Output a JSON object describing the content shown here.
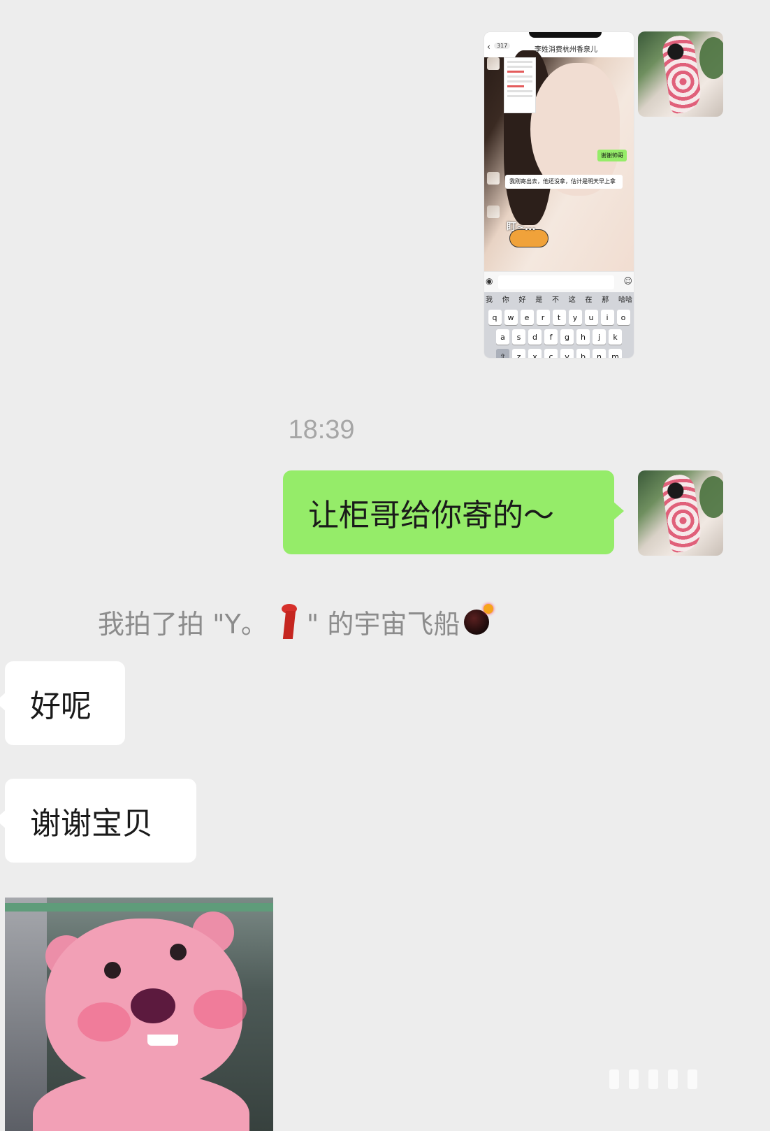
{
  "messages": {
    "screenshot": {
      "nav_back": "‹",
      "nav_count": "317",
      "nav_title": "李姓消费杭州香泉儿",
      "green_bubble": "谢谢帅哥",
      "white_bubble": "我刚寄出去，他还没拿，估计是明天早上拿",
      "sticker_text": "盯~...",
      "candidates": [
        "我",
        "你",
        "好",
        "是",
        "不",
        "这",
        "在",
        "那",
        "哈哈"
      ],
      "keys_row1": [
        "q",
        "w",
        "e",
        "r",
        "t",
        "y",
        "u",
        "i",
        "o"
      ],
      "keys_row2": [
        "a",
        "s",
        "d",
        "f",
        "g",
        "h",
        "j",
        "k"
      ],
      "keys_row3": [
        "z",
        "x",
        "c",
        "v",
        "b",
        "n",
        "m"
      ]
    },
    "timestamp": "18:39",
    "sent_text": "让柜哥给你寄的～",
    "pat_prefix": "我拍了拍 \"Y。",
    "pat_suffix": "\" 的宇宙飞船",
    "reply1": "好呢",
    "reply2": "谢谢宝贝"
  },
  "colors": {
    "background": "#ededed",
    "sent_bubble": "#95ec69",
    "received_bubble": "#ffffff",
    "system_text": "#8c8c8c"
  },
  "icons": [
    "avatar-image",
    "scarf-emoji",
    "bomb-emoji",
    "pink-beaver-sticker"
  ]
}
